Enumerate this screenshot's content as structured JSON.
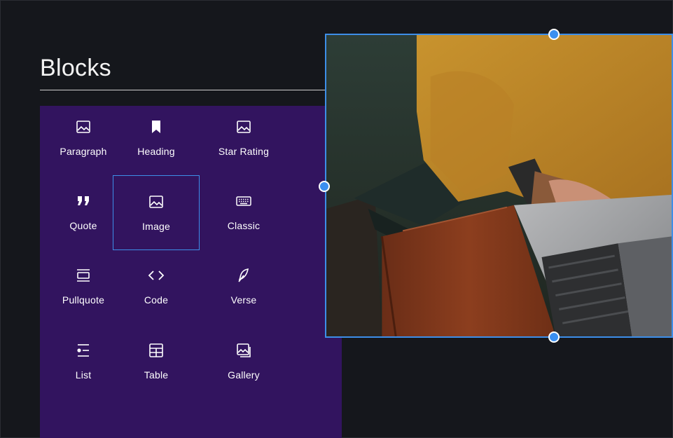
{
  "panel": {
    "title": "Blocks",
    "blocks": [
      {
        "label": "Paragraph",
        "icon": "image-icon"
      },
      {
        "label": "Heading",
        "icon": "bookmark-icon"
      },
      {
        "label": "Star Rating",
        "icon": "image-icon"
      },
      {
        "label": "Quote",
        "icon": "quote-icon"
      },
      {
        "label": "Image",
        "icon": "image-icon",
        "selected": true
      },
      {
        "label": "Classic",
        "icon": "keyboard-icon"
      },
      {
        "label": "Pullquote",
        "icon": "pullquote-icon"
      },
      {
        "label": "Code",
        "icon": "code-icon"
      },
      {
        "label": "Verse",
        "icon": "feather-icon"
      },
      {
        "label": "List",
        "icon": "list-icon"
      },
      {
        "label": "Table",
        "icon": "table-icon"
      },
      {
        "label": "Gallery",
        "icon": "gallery-icon"
      }
    ]
  },
  "colors": {
    "background": "#15171c",
    "panel": "#32145f",
    "accent": "#3d8ee8"
  }
}
